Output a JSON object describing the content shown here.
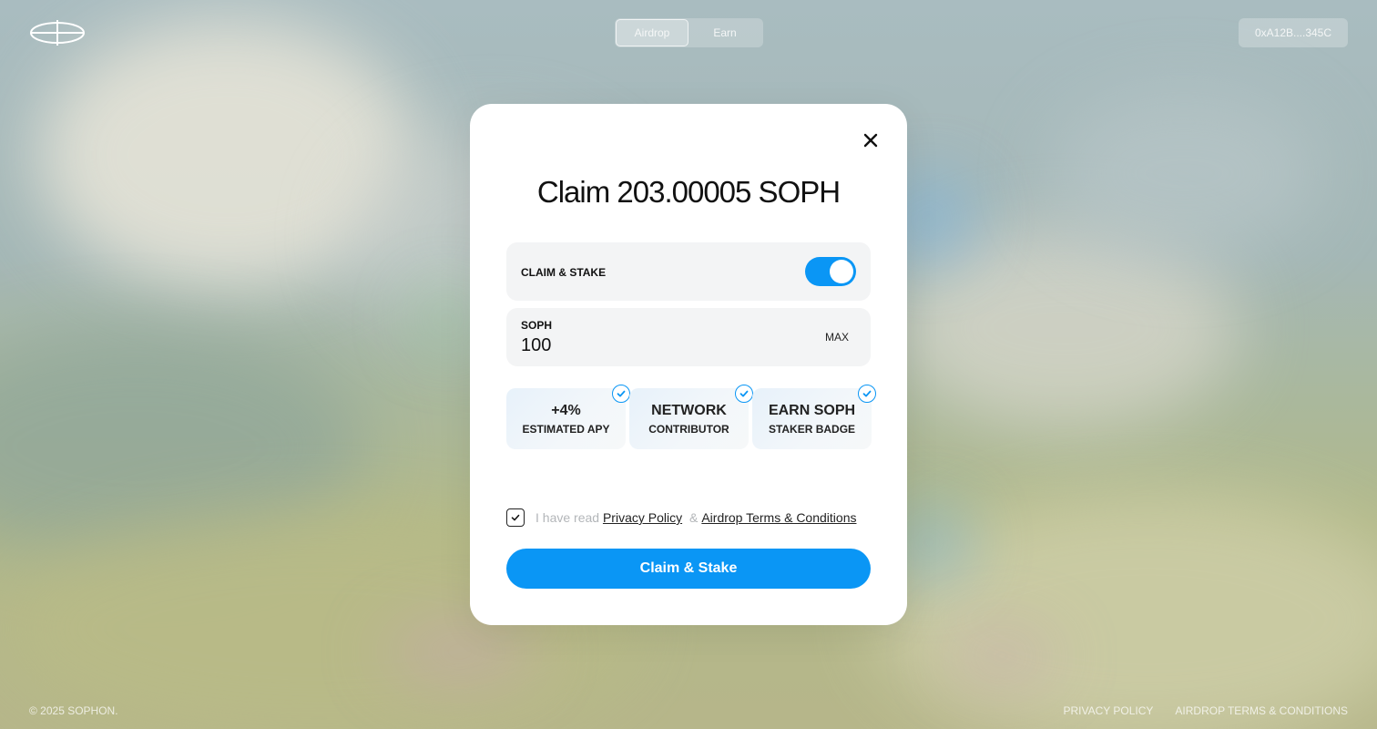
{
  "header": {
    "nav_tabs": [
      {
        "label": "Airdrop",
        "active": true
      },
      {
        "label": "Earn",
        "active": false
      }
    ],
    "wallet_address": "0xA12B....345C"
  },
  "modal": {
    "title": "Claim 203.00005 SOPH",
    "claim_stake": {
      "label": "CLAIM & STAKE",
      "enabled": true
    },
    "amount": {
      "label": "SOPH",
      "value": "100",
      "max_label": "MAX"
    },
    "benefits": [
      {
        "big": "+4%",
        "small": "ESTIMATED APY",
        "checked": true
      },
      {
        "big": "NETWORK",
        "small": "CONTRIBUTOR",
        "checked": true
      },
      {
        "big": "EARN SOPH",
        "small": "STAKER BADGE",
        "checked": true
      }
    ],
    "consent": {
      "checked": true,
      "prefix": "I have read",
      "privacy_link": "Privacy Policy",
      "separator": "&",
      "terms_link": "Airdrop Terms & Conditions"
    },
    "cta_label": "Claim & Stake"
  },
  "footer": {
    "copyright": "© 2025 SOPHON.",
    "links": [
      "PRIVACY POLICY",
      "AIRDROP TERMS & CONDITIONS"
    ]
  },
  "colors": {
    "accent": "#0a96f5",
    "modal_bg": "#ffffff",
    "row_bg": "#f3f4f5"
  }
}
